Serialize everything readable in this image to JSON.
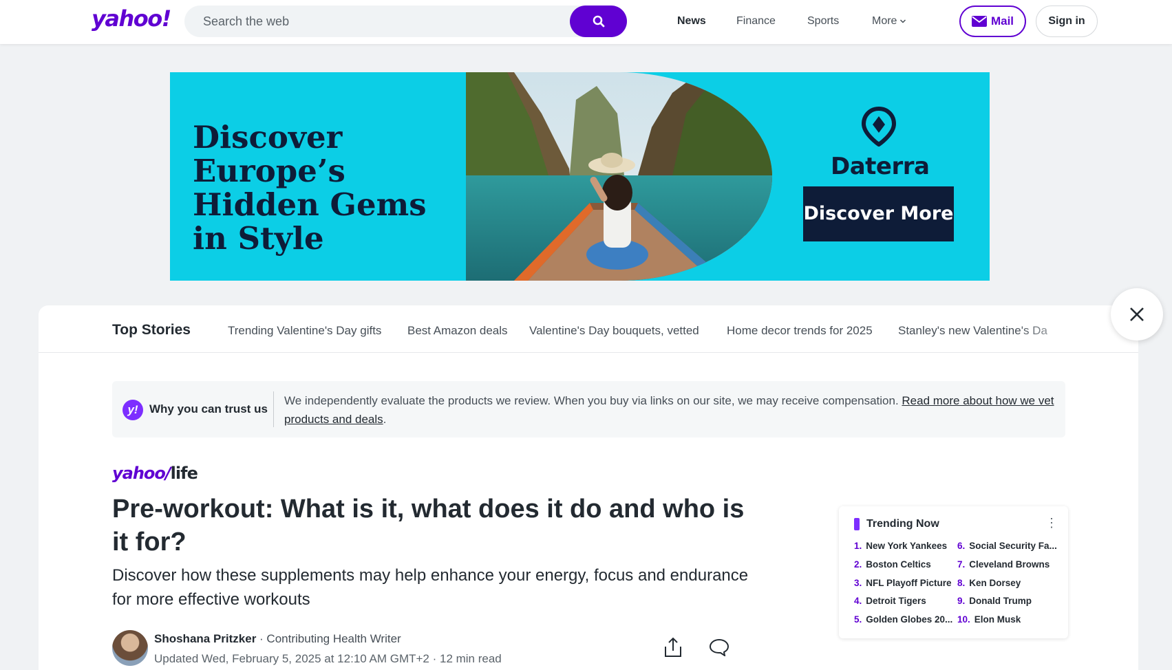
{
  "header": {
    "logo": "yahoo!",
    "search_placeholder": "Search the web",
    "nav": [
      "News",
      "Finance",
      "Sports",
      "More"
    ],
    "mail_label": "Mail",
    "signin_label": "Sign in"
  },
  "ad": {
    "headline": "Discover Europe’s Hidden Gems in Style",
    "brand": "Daterra",
    "cta": "Discover More"
  },
  "top_stories": {
    "title": "Top Stories",
    "links": [
      "Trending Valentine's Day gifts",
      "Best Amazon deals",
      "Valentine's Day bouquets, vetted",
      "Home decor trends for 2025",
      "Stanley's new Valentine's Da"
    ]
  },
  "trust": {
    "badge": "y!",
    "title": "Why you can trust us",
    "text": "We independently evaluate the products we review. When you buy via links on our site, we may receive compensation.",
    "link": "Read more about how we vet products and deals",
    "trailing": "."
  },
  "article": {
    "brand_yahoo": "yahoo/",
    "brand_life": "life",
    "headline": "Pre-workout: What is it, what does it do and who is it for?",
    "subhead": "Discover how these supplements may help enhance your energy, focus and endurance for more effective workouts",
    "author": "Shoshana Pritzker",
    "author_role": " · Contributing Health Writer",
    "updated": "Updated Wed, February 5, 2025 at 12:10 AM GMT+2 · 12 min read"
  },
  "trending": {
    "title": "Trending Now",
    "menu": "⋮",
    "items": [
      {
        "num": "1.",
        "label": "New York Yankees"
      },
      {
        "num": "2.",
        "label": "Boston Celtics"
      },
      {
        "num": "3.",
        "label": "NFL Playoff Picture"
      },
      {
        "num": "4.",
        "label": "Detroit Tigers"
      },
      {
        "num": "5.",
        "label": "Golden Globes 20..."
      },
      {
        "num": "6.",
        "label": "Social Security Fa..."
      },
      {
        "num": "7.",
        "label": "Cleveland Browns"
      },
      {
        "num": "8.",
        "label": "Ken Dorsey"
      },
      {
        "num": "9.",
        "label": "Donald Trump"
      },
      {
        "num": "10.",
        "label": "Elon Musk"
      }
    ]
  },
  "colors": {
    "brand_purple": "#6001d2",
    "ad_cyan": "#0ccee6",
    "ad_navy": "#0e1c38"
  }
}
